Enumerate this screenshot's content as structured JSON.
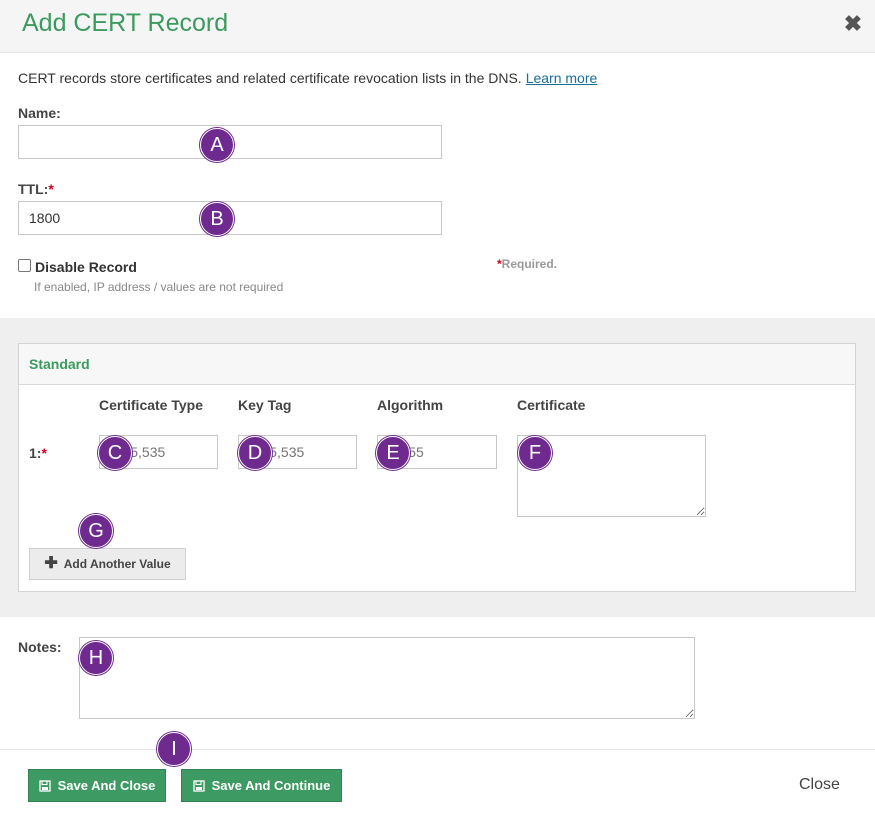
{
  "header": {
    "title": "Add CERT Record",
    "close_glyph": "✖"
  },
  "intro": {
    "text": "CERT records store certificates and related certificate revocation lists in the DNS.",
    "link": "Learn more"
  },
  "name_field": {
    "label": "Name:",
    "value": ""
  },
  "ttl_field": {
    "label": "TTL:",
    "required_mark": "*",
    "value": "1800"
  },
  "disable_record": {
    "label": "Disable Record",
    "hint": "If enabled, IP address / values are not required",
    "checked": false
  },
  "required_note": {
    "mark": "*",
    "text": "Required."
  },
  "standard": {
    "title": "Standard",
    "columns": [
      "Certificate Type",
      "Key Tag",
      "Algorithm",
      "Certificate"
    ],
    "row_label": "1:",
    "row_required_mark": "*",
    "placeholders": {
      "certificate_type": "0-65,535",
      "key_tag": "0-65,535",
      "algorithm": "0-255"
    },
    "add_button": "Add Another Value",
    "add_icon": "plus-icon"
  },
  "notes": {
    "label": "Notes:",
    "value": ""
  },
  "footer": {
    "save_close": "Save And Close",
    "save_continue": "Save And Continue",
    "close": "Close",
    "save_icon": "floppy-disk-icon"
  },
  "badges": [
    "A",
    "B",
    "C",
    "D",
    "E",
    "F",
    "G",
    "H",
    "I"
  ],
  "colors": {
    "accent_green": "#3c9a5f",
    "button_green": "#3d9a62",
    "badge_purple": "#6e2a8e",
    "required_red": "#d0021b",
    "link_blue": "#1a6e9a"
  }
}
